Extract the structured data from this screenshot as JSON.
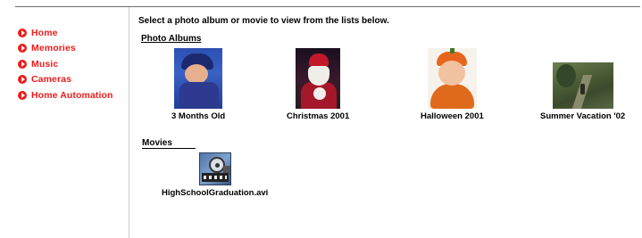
{
  "sidebar": {
    "items": [
      {
        "label": "Home"
      },
      {
        "label": "Memories"
      },
      {
        "label": "Music"
      },
      {
        "label": "Cameras"
      },
      {
        "label": "Home Automation"
      }
    ]
  },
  "main": {
    "instructions": "Select a photo album or movie to view from the lists below.",
    "albums_heading": "Photo Albums",
    "albums": [
      {
        "caption": "3 Months Old"
      },
      {
        "caption": "Christmas 2001"
      },
      {
        "caption": "Halloween 2001"
      },
      {
        "caption": "Summer Vacation '02"
      }
    ],
    "movies_heading": "Movies",
    "movies": [
      {
        "caption": "HighSchoolGraduation.avi"
      }
    ]
  },
  "colors": {
    "nav_accent": "#ee1c1c"
  }
}
